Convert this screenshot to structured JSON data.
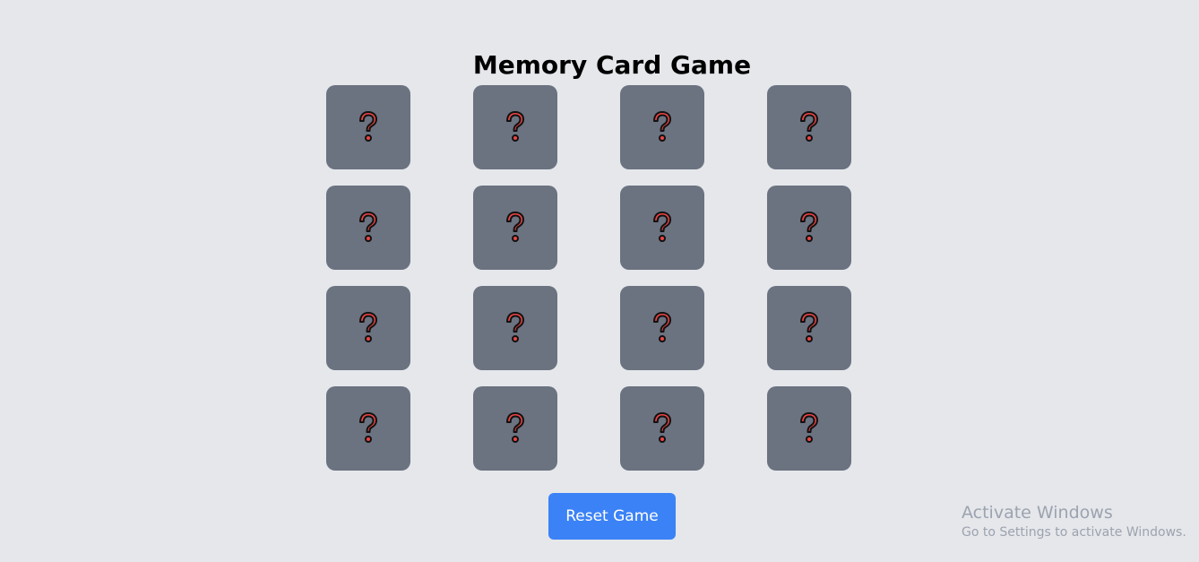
{
  "title": "Memory Card Game",
  "grid": {
    "rows": 4,
    "columns": 4,
    "card_face": "?",
    "card_back_icon": "red-question-mark-icon",
    "card_color": "#6b7280",
    "icon_color": "#ef4444"
  },
  "reset_button": {
    "label": "Reset Game",
    "color": "#3b82f6"
  },
  "watermark": {
    "title": "Activate Windows",
    "subtitle": "Go to Settings to activate Windows."
  },
  "colors": {
    "background": "#e5e7eb"
  }
}
